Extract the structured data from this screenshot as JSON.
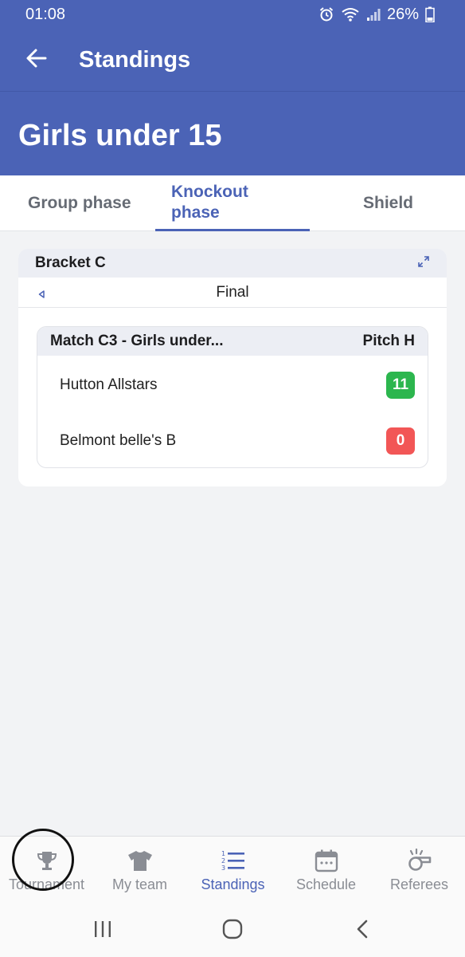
{
  "status": {
    "time": "01:08",
    "battery": "26%"
  },
  "appbar": {
    "title": "Standings",
    "back_icon": "arrow-left-icon"
  },
  "hero": {
    "title": "Girls under 15"
  },
  "tabs": [
    {
      "label": "Group phase"
    },
    {
      "label": "Knockout phase",
      "active": true
    },
    {
      "label": "Shield"
    }
  ],
  "bracket": {
    "title": "Bracket C",
    "round": "Final",
    "match": {
      "title": "Match C3 - Girls under...",
      "pitch": "Pitch H",
      "teams": [
        {
          "name": "Hutton Allstars",
          "score": "11",
          "result": "win"
        },
        {
          "name": "Belmont belle's B",
          "score": "0",
          "result": "loss"
        }
      ]
    }
  },
  "nav": {
    "items": [
      {
        "label": "Tournament",
        "icon": "trophy-icon"
      },
      {
        "label": "My team",
        "icon": "shirt-icon"
      },
      {
        "label": "Standings",
        "icon": "ranked-list-icon",
        "active": true
      },
      {
        "label": "Schedule",
        "icon": "calendar-icon"
      },
      {
        "label": "Referees",
        "icon": "whistle-icon"
      }
    ]
  },
  "colors": {
    "primary": "#4b63b6",
    "win": "#2cb64e",
    "loss": "#f25656",
    "background": "#f2f3f5"
  }
}
